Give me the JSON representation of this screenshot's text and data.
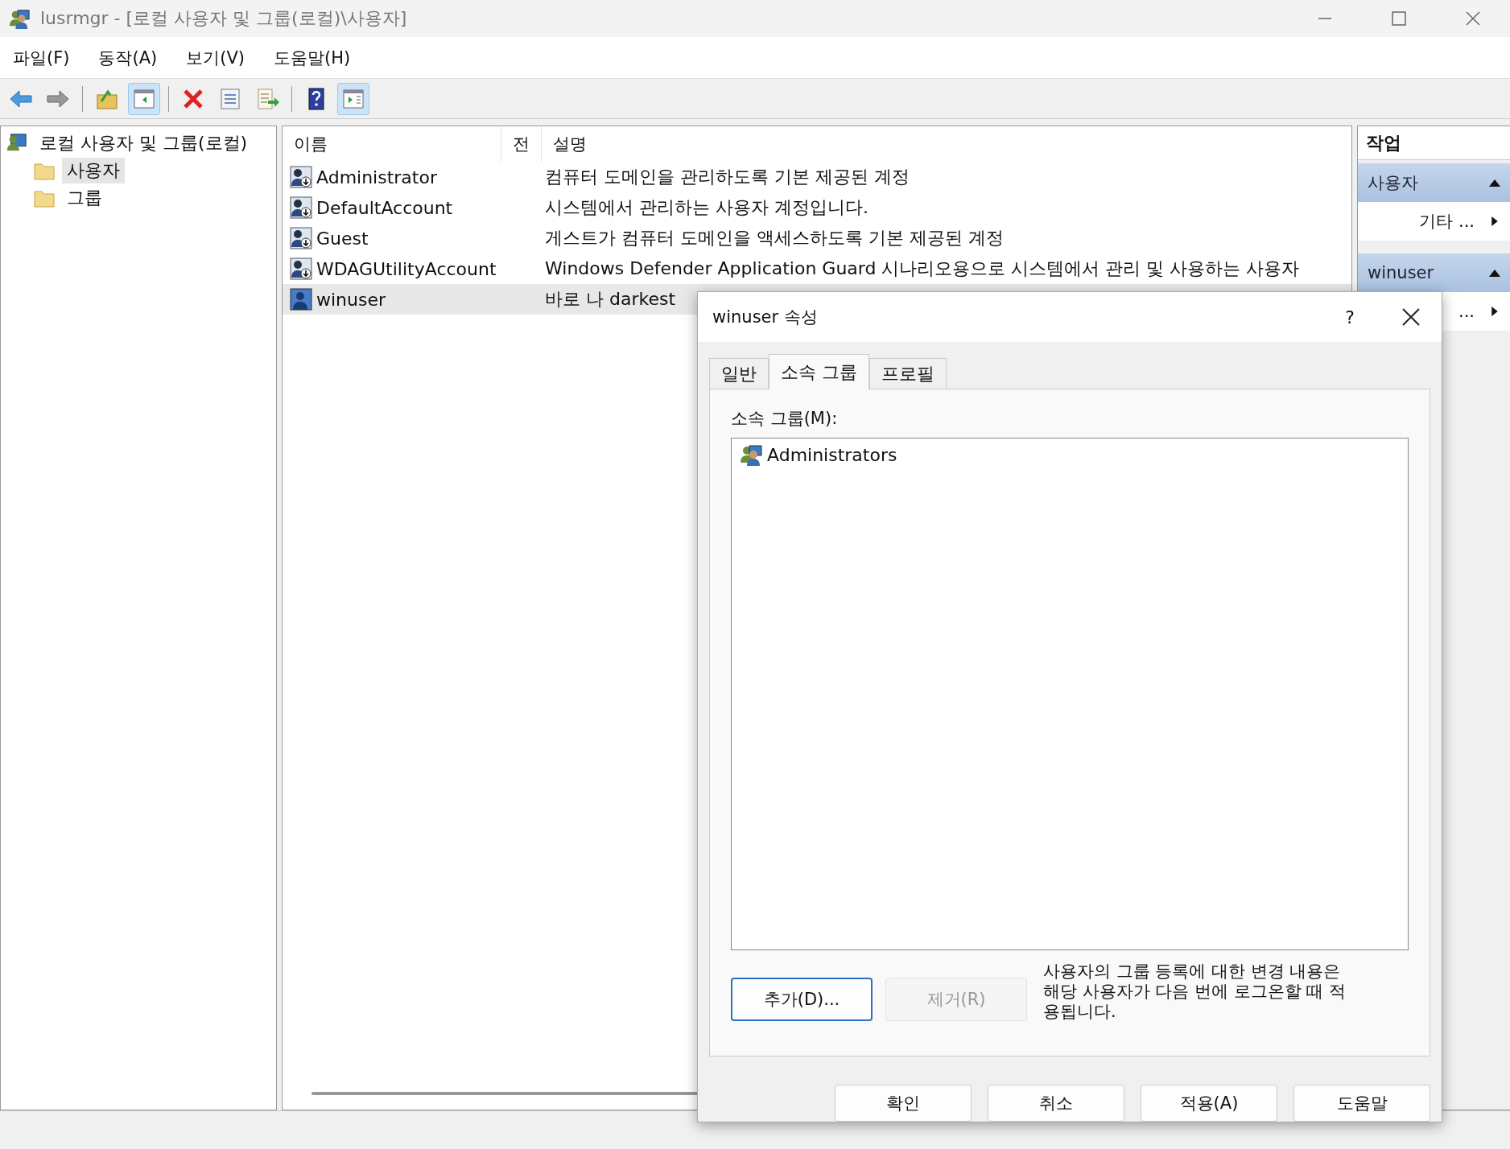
{
  "window": {
    "title": "lusrmgr - [로컬 사용자 및 그룹(로컬)\\사용자]"
  },
  "menu": [
    "파일(F)",
    "동작(A)",
    "보기(V)",
    "도움말(H)"
  ],
  "toolbar": [
    {
      "kind": "back",
      "selected": false
    },
    {
      "kind": "forward",
      "selected": false
    },
    {
      "kind": "sep"
    },
    {
      "kind": "up",
      "selected": false
    },
    {
      "kind": "tree",
      "selected": true
    },
    {
      "kind": "sep"
    },
    {
      "kind": "delete",
      "selected": false
    },
    {
      "kind": "properties",
      "selected": false
    },
    {
      "kind": "export",
      "selected": false
    },
    {
      "kind": "sep"
    },
    {
      "kind": "help",
      "selected": false
    },
    {
      "kind": "actionpane",
      "selected": true
    }
  ],
  "tree": {
    "label": "로컬 사용자 및 그룹(로컬)",
    "children": [
      {
        "label": "사용자",
        "selected": true
      },
      {
        "label": "그룹",
        "selected": false
      }
    ]
  },
  "list": {
    "columns": [
      "이름",
      "전",
      "설명"
    ],
    "rows": [
      {
        "name": "Administrator",
        "description": "컴퓨터 도메인을 관리하도록 기본 제공된 계정",
        "kind": "disabled-account",
        "selected": false
      },
      {
        "name": "DefaultAccount",
        "description": "시스템에서 관리하는 사용자 계정입니다.",
        "kind": "disabled-account",
        "selected": false
      },
      {
        "name": "Guest",
        "description": "게스트가 컴퓨터 도메인을 액세스하도록 기본 제공된 계정",
        "kind": "disabled-account",
        "selected": false
      },
      {
        "name": "WDAGUtilityAccount",
        "description": "Windows Defender Application Guard 시나리오용으로 시스템에서 관리 및 사용하는 사용자",
        "kind": "disabled-account",
        "selected": false
      },
      {
        "name": "winuser",
        "description": "바로 나 darkest",
        "kind": "account",
        "selected": true
      }
    ]
  },
  "actions": {
    "title": "작업",
    "sections": [
      {
        "label": "사용자",
        "expanded": true,
        "items": [
          "기타 ..."
        ]
      },
      {
        "label": "winuser",
        "expanded": true,
        "items": [
          "..."
        ]
      }
    ]
  },
  "dialog": {
    "title": "winuser 속성",
    "help": "?",
    "tabs": [
      {
        "label": "일반",
        "selected": false
      },
      {
        "label": "소속 그룹",
        "selected": true
      },
      {
        "label": "프로필",
        "selected": false
      }
    ],
    "group_label": "소속 그룹(M):",
    "groups": [
      "Administrators"
    ],
    "buttons": [
      {
        "label": "추가(D)...",
        "disabled": false
      },
      {
        "label": "제거(R)",
        "disabled": true
      }
    ],
    "note": "사용자의 그룹 등록에 대한 변경 내용은 해당 사용자가 다음 번에 로그온할 때 적용됩니다.",
    "footer_buttons": [
      "확인",
      "취소",
      "적용(A)",
      "도움말"
    ]
  }
}
